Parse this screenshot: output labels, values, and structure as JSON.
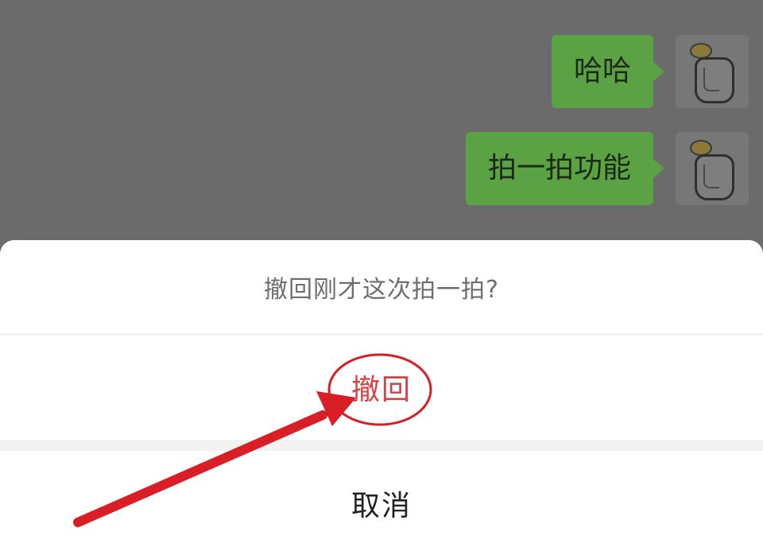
{
  "chat": {
    "messages": [
      {
        "text": "哈哈",
        "sender": "self"
      },
      {
        "text": "拍一拍功能",
        "sender": "self"
      }
    ]
  },
  "action_sheet": {
    "title": "撤回刚才这次拍一拍?",
    "revoke_label": "撤回",
    "cancel_label": "取消"
  },
  "colors": {
    "overlay": "#6b6b6b",
    "bubble": "#5aa243",
    "revoke_text": "#d64242",
    "annotation": "#d91e26"
  },
  "icons": {
    "avatar": "avatar-icon",
    "annotation_arrow": "arrow-icon",
    "annotation_circle": "circle-highlight-icon"
  }
}
